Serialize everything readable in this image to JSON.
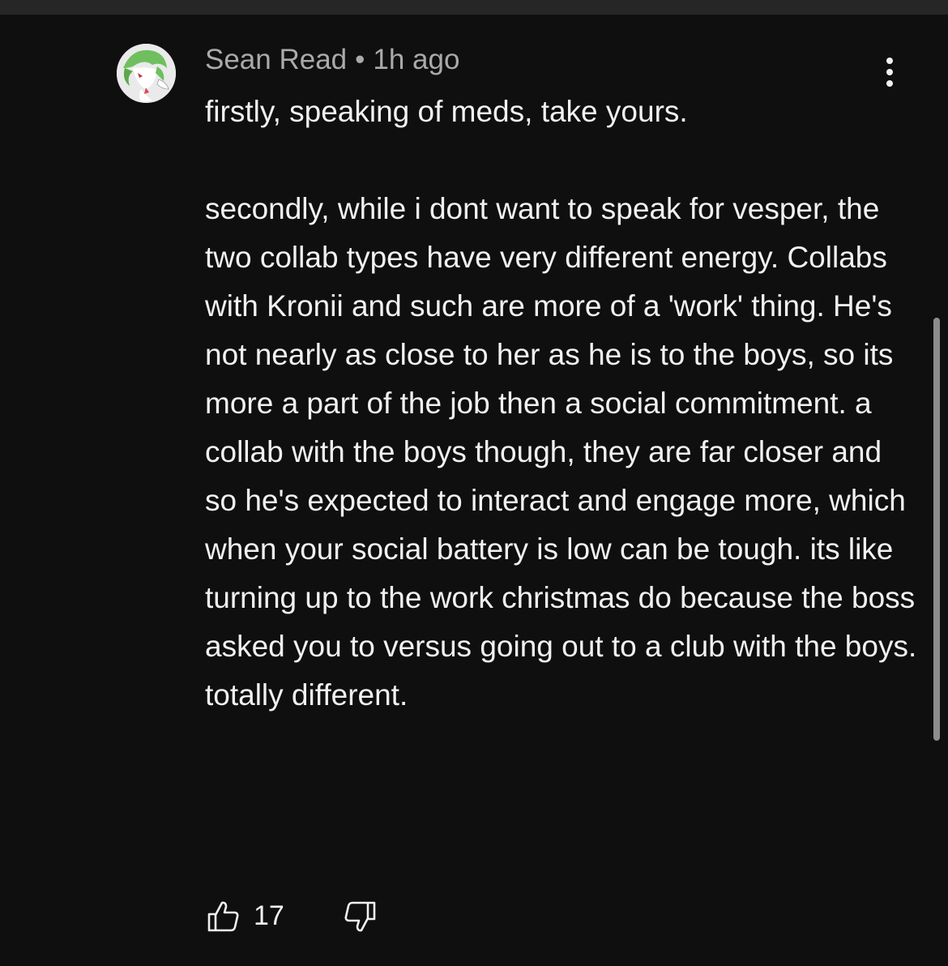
{
  "comment": {
    "author": "Sean Read",
    "separator": "•",
    "timestamp": "1h ago",
    "avatar_icon": "gardevoir-avatar-icon",
    "text": "firstly, speaking of meds, take yours.\n\nsecondly, while i dont want to speak for vesper, the two collab types have very different energy. Collabs with Kronii and such are more of a 'work' thing. He's not nearly as close to her as he is to the boys, so its more a part of the job then a social commitment. a collab with the boys though, they are far closer and so he's expected to interact and engage more, which when your social battery is low can be tough. its like turning up to the work christmas do because the boss asked you to versus going out to a club with the boys. totally different.",
    "like_count": "17",
    "icons": {
      "menu": "more-vertical-icon",
      "like": "thumbs-up-icon",
      "dislike": "thumbs-down-icon"
    }
  },
  "colors": {
    "background": "#0f0f0f",
    "text": "#f1f1f1",
    "meta": "#aaaaaa",
    "scrollbar": "#8c8c8c",
    "avatar_green": "#6fbf5f"
  }
}
